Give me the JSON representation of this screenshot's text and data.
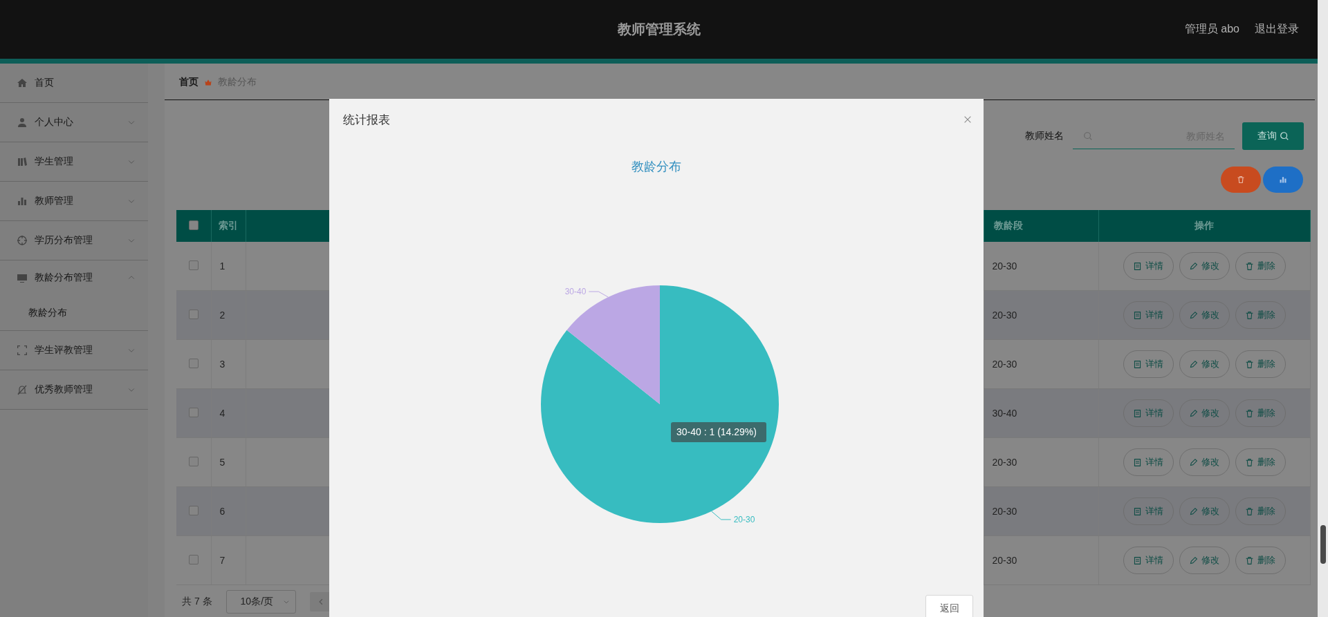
{
  "header": {
    "title": "教师管理系统",
    "user": "管理员 abo",
    "logout": "退出登录"
  },
  "sidebar": {
    "items": [
      {
        "label": "首页",
        "kind": "link"
      },
      {
        "label": "个人中心",
        "kind": "group",
        "expanded": false
      },
      {
        "label": "学生管理",
        "kind": "group",
        "expanded": false
      },
      {
        "label": "教师管理",
        "kind": "group",
        "expanded": false
      },
      {
        "label": "学历分布管理",
        "kind": "group",
        "expanded": false
      },
      {
        "label": "教龄分布管理",
        "kind": "group",
        "expanded": true,
        "children": [
          {
            "label": "教龄分布"
          }
        ]
      },
      {
        "label": "学生评教管理",
        "kind": "group",
        "expanded": false
      },
      {
        "label": "优秀教师管理",
        "kind": "group",
        "expanded": false
      }
    ]
  },
  "breadcrumb": [
    "首页",
    "教龄分布"
  ],
  "search": {
    "label": "教师姓名",
    "placeholder": "教师姓名",
    "button": "查询"
  },
  "table": {
    "header_checked": false,
    "columns": [
      "索引",
      "教龄段",
      "操作"
    ],
    "rows": [
      {
        "checked": false,
        "index": "1",
        "band": "20-30",
        "actions": [
          "详情",
          "修改",
          "删除"
        ]
      },
      {
        "checked": false,
        "index": "2",
        "band": "20-30",
        "actions": [
          "详情",
          "修改",
          "删除"
        ]
      },
      {
        "checked": false,
        "index": "3",
        "band": "20-30",
        "actions": [
          "详情",
          "修改",
          "删除"
        ]
      },
      {
        "checked": false,
        "index": "4",
        "band": "30-40",
        "actions": [
          "详情",
          "修改",
          "删除"
        ]
      },
      {
        "checked": false,
        "index": "5",
        "band": "20-30",
        "actions": [
          "详情",
          "修改",
          "删除"
        ]
      },
      {
        "checked": false,
        "index": "6",
        "band": "20-30",
        "actions": [
          "详情",
          "修改",
          "删除"
        ]
      },
      {
        "checked": false,
        "index": "7",
        "band": "20-30",
        "actions": [
          "详情",
          "修改",
          "删除"
        ]
      }
    ]
  },
  "pagination": {
    "total": "共 7 条",
    "page_size": "10条/页"
  },
  "dialog": {
    "title": "统计报表",
    "chart_data": {
      "type": "pie",
      "title": "教龄分布",
      "categories": [
        "20-30",
        "30-40"
      ],
      "values": [
        85.71,
        14.29
      ],
      "colors": [
        "#37bcc0",
        "#bba7e4"
      ]
    },
    "tooltip": "30-40 : 1 (14.29%)",
    "button": "返回"
  }
}
